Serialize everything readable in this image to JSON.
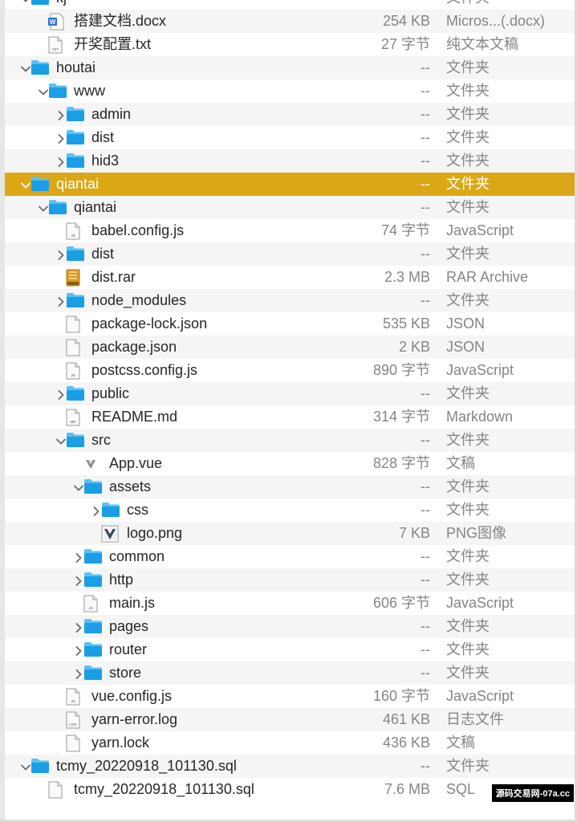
{
  "rows": [
    {
      "name": "kj",
      "size": "--",
      "kind": "文件夹",
      "depth": 1,
      "type": "folder",
      "disclosure": "open"
    },
    {
      "name": "搭建文档.docx",
      "size": "254 KB",
      "kind": "Micros...(.docx)",
      "depth": 2,
      "type": "docx",
      "disclosure": "none"
    },
    {
      "name": "开奖配置.txt",
      "size": "27 字节",
      "kind": "纯文本文稿",
      "depth": 2,
      "type": "txt",
      "disclosure": "none"
    },
    {
      "name": "houtai",
      "size": "--",
      "kind": "文件夹",
      "depth": 1,
      "type": "folder",
      "disclosure": "open"
    },
    {
      "name": "www",
      "size": "--",
      "kind": "文件夹",
      "depth": 2,
      "type": "folder",
      "disclosure": "open"
    },
    {
      "name": "admin",
      "size": "--",
      "kind": "文件夹",
      "depth": 3,
      "type": "folder",
      "disclosure": "closed"
    },
    {
      "name": "dist",
      "size": "--",
      "kind": "文件夹",
      "depth": 3,
      "type": "folder",
      "disclosure": "closed"
    },
    {
      "name": "hid3",
      "size": "--",
      "kind": "文件夹",
      "depth": 3,
      "type": "folder",
      "disclosure": "closed"
    },
    {
      "name": "qiantai",
      "size": "--",
      "kind": "文件夹",
      "depth": 1,
      "type": "folder",
      "disclosure": "open",
      "selected": true
    },
    {
      "name": "qiantai",
      "size": "--",
      "kind": "文件夹",
      "depth": 2,
      "type": "folder",
      "disclosure": "open"
    },
    {
      "name": "babel.config.js",
      "size": "74 字节",
      "kind": "JavaScript",
      "depth": 3,
      "type": "js",
      "disclosure": "none"
    },
    {
      "name": "dist",
      "size": "--",
      "kind": "文件夹",
      "depth": 3,
      "type": "folder",
      "disclosure": "closed"
    },
    {
      "name": "dist.rar",
      "size": "2.3 MB",
      "kind": "RAR Archive",
      "depth": 3,
      "type": "rar",
      "disclosure": "none"
    },
    {
      "name": "node_modules",
      "size": "--",
      "kind": "文件夹",
      "depth": 3,
      "type": "folder",
      "disclosure": "closed"
    },
    {
      "name": "package-lock.json",
      "size": "535 KB",
      "kind": "JSON",
      "depth": 3,
      "type": "json",
      "disclosure": "none"
    },
    {
      "name": "package.json",
      "size": "2 KB",
      "kind": "JSON",
      "depth": 3,
      "type": "json",
      "disclosure": "none"
    },
    {
      "name": "postcss.config.js",
      "size": "890 字节",
      "kind": "JavaScript",
      "depth": 3,
      "type": "js",
      "disclosure": "none"
    },
    {
      "name": "public",
      "size": "--",
      "kind": "文件夹",
      "depth": 3,
      "type": "folder",
      "disclosure": "closed"
    },
    {
      "name": "README.md",
      "size": "314 字节",
      "kind": "Markdown",
      "depth": 3,
      "type": "md",
      "disclosure": "none"
    },
    {
      "name": "src",
      "size": "--",
      "kind": "文件夹",
      "depth": 3,
      "type": "folder",
      "disclosure": "open"
    },
    {
      "name": "App.vue",
      "size": "828 字节",
      "kind": "文稿",
      "depth": 4,
      "type": "vue",
      "disclosure": "none"
    },
    {
      "name": "assets",
      "size": "--",
      "kind": "文件夹",
      "depth": 4,
      "type": "folder",
      "disclosure": "open"
    },
    {
      "name": "css",
      "size": "--",
      "kind": "文件夹",
      "depth": 5,
      "type": "folder",
      "disclosure": "closed"
    },
    {
      "name": "logo.png",
      "size": "7 KB",
      "kind": "PNG图像",
      "depth": 5,
      "type": "png",
      "disclosure": "none"
    },
    {
      "name": "common",
      "size": "--",
      "kind": "文件夹",
      "depth": 4,
      "type": "folder",
      "disclosure": "closed"
    },
    {
      "name": "http",
      "size": "--",
      "kind": "文件夹",
      "depth": 4,
      "type": "folder",
      "disclosure": "closed"
    },
    {
      "name": "main.js",
      "size": "606 字节",
      "kind": "JavaScript",
      "depth": 4,
      "type": "js",
      "disclosure": "none"
    },
    {
      "name": "pages",
      "size": "--",
      "kind": "文件夹",
      "depth": 4,
      "type": "folder",
      "disclosure": "closed"
    },
    {
      "name": "router",
      "size": "--",
      "kind": "文件夹",
      "depth": 4,
      "type": "folder",
      "disclosure": "closed"
    },
    {
      "name": "store",
      "size": "--",
      "kind": "文件夹",
      "depth": 4,
      "type": "folder",
      "disclosure": "closed"
    },
    {
      "name": "vue.config.js",
      "size": "160 字节",
      "kind": "JavaScript",
      "depth": 3,
      "type": "js",
      "disclosure": "none"
    },
    {
      "name": "yarn-error.log",
      "size": "461 KB",
      "kind": "日志文件",
      "depth": 3,
      "type": "log",
      "disclosure": "none"
    },
    {
      "name": "yarn.lock",
      "size": "436 KB",
      "kind": "文稿",
      "depth": 3,
      "type": "lock",
      "disclosure": "none"
    },
    {
      "name": "tcmy_20220918_101130.sql",
      "size": "--",
      "kind": "文件夹",
      "depth": 1,
      "type": "folder",
      "disclosure": "open"
    },
    {
      "name": "tcmy_20220918_101130.sql",
      "size": "7.6 MB",
      "kind": "SQL",
      "depth": 2,
      "type": "sql",
      "disclosure": "none"
    }
  ],
  "watermark": "源码交易网-07a.cc",
  "colors": {
    "selection": "#dba717",
    "folder": "#1a9ee6",
    "folder_tab": "#5bc0f5",
    "text": "#262626",
    "secondary_text": "#858585"
  }
}
